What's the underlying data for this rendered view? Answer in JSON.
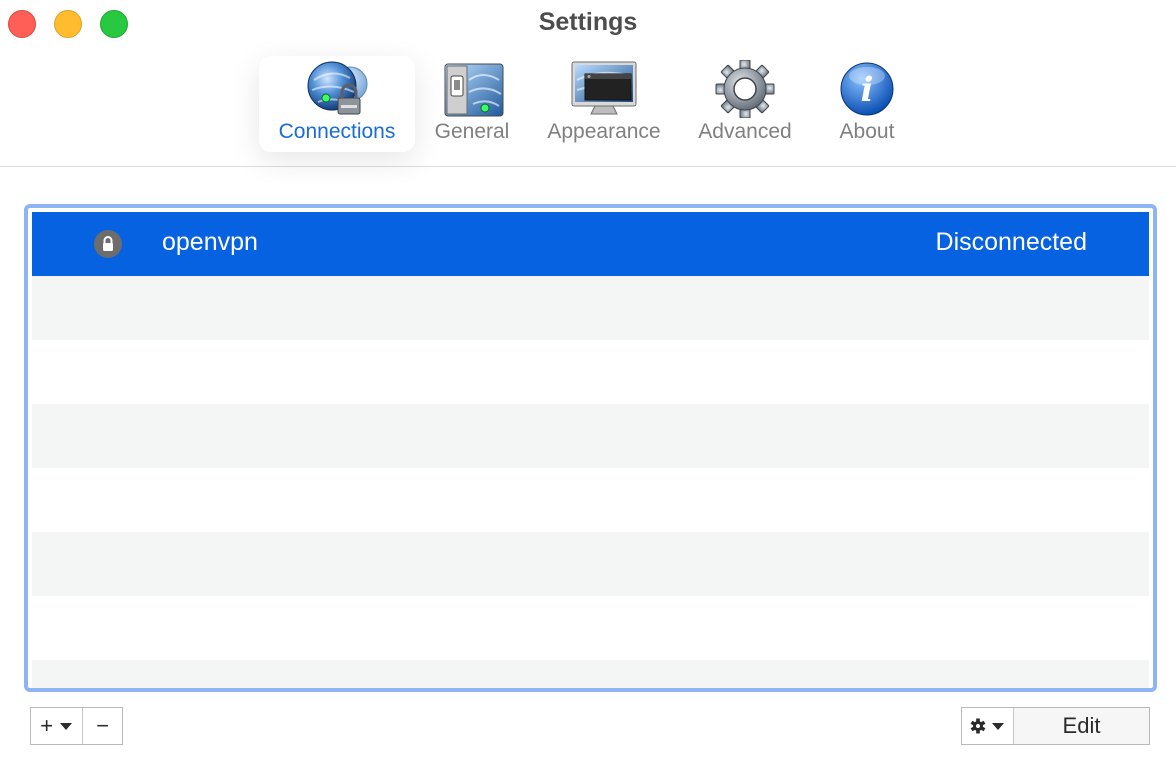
{
  "window": {
    "title": "Settings"
  },
  "toolbar": {
    "items": [
      {
        "label": "Connections",
        "icon": "globe-lock-icon",
        "selected": true
      },
      {
        "label": "General",
        "icon": "switch-icon",
        "selected": false
      },
      {
        "label": "Appearance",
        "icon": "monitor-icon",
        "selected": false
      },
      {
        "label": "Advanced",
        "icon": "gear-icon",
        "selected": false
      },
      {
        "label": "About",
        "icon": "info-icon",
        "selected": false
      }
    ]
  },
  "connections": {
    "rows": [
      {
        "name": "openvpn",
        "status": "Disconnected",
        "icon": "lock-icon",
        "selected": true
      }
    ]
  },
  "footer": {
    "add_symbol": "+",
    "remove_symbol": "−",
    "edit_label": "Edit"
  },
  "colors": {
    "accent": "#1a6dd6",
    "selection": "#0662e0",
    "frame": "#8fb4f3",
    "close": "#ff5f57",
    "minimize": "#febc2e",
    "zoom": "#28c840"
  }
}
